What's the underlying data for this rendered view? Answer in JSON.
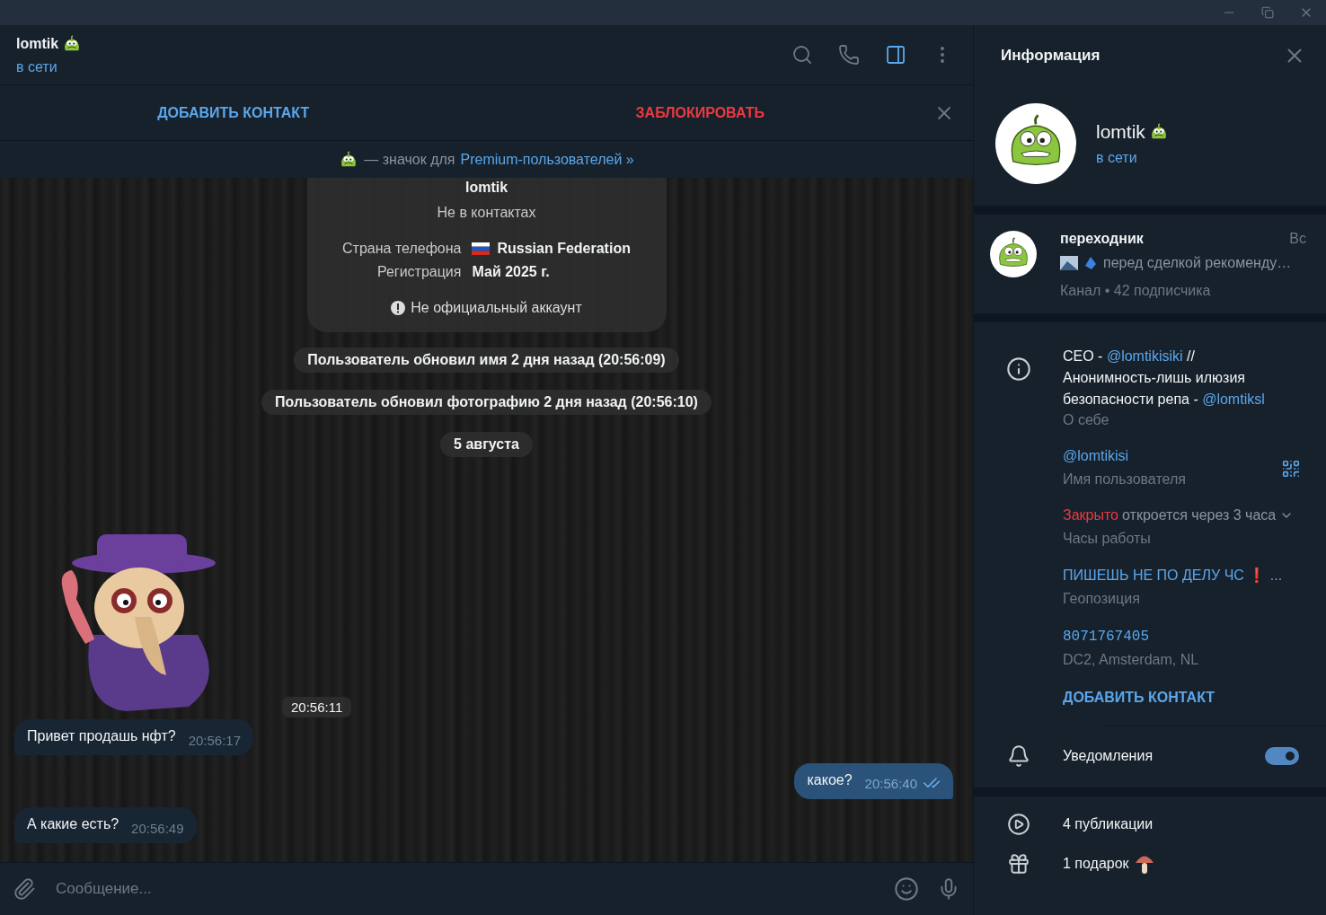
{
  "chat_header": {
    "name": "lomtik",
    "status": "в сети"
  },
  "action_bar": {
    "add_contact": "ДОБАВИТЬ КОНТАКТ",
    "block": "ЗАБЛОКИРОВАТЬ"
  },
  "premium_notice": {
    "text": "— значок для ",
    "link": "Premium-пользователей »"
  },
  "info_card": {
    "name": "lomtik",
    "subtitle": "Не в контактах",
    "rows": [
      {
        "label": "Страна телефона",
        "value": "Russian Federation",
        "kind": "country"
      },
      {
        "label": "Регистрация",
        "value": "Май 2025 г.",
        "kind": "date"
      }
    ],
    "note": "Не официальный аккаунт"
  },
  "messages": [
    {
      "kind": "service",
      "text": "Пользователь обновил имя 2 дня назад (20:56:09)"
    },
    {
      "kind": "service",
      "text": "Пользователь обновил фотографию 2 дня назад (20:56:10)"
    },
    {
      "kind": "date",
      "text": "5 августа"
    },
    {
      "kind": "sticker",
      "time": "20:56:11"
    },
    {
      "kind": "incoming",
      "text": "Привет продашь нфт?",
      "time": "20:56:17"
    },
    {
      "kind": "outgoing",
      "text": "какое?",
      "time": "20:56:40",
      "read": true
    },
    {
      "kind": "incoming",
      "text": "А какие есть?",
      "time": "20:56:49"
    }
  ],
  "composer": {
    "placeholder": "Сообщение..."
  },
  "info_panel": {
    "title": "Информация",
    "name": "lomtik",
    "status": "в сети",
    "channel": {
      "name": "переходник",
      "date": "Вс",
      "preview": "перед сделкой рекоменду…",
      "meta": "Канал • 42 подписчика"
    },
    "bio": {
      "parts": [
        {
          "text": "CEO - ",
          "link": false
        },
        {
          "text": "@lomtikisiki",
          "link": true
        },
        {
          "text": " //Анонимность-лишь илюзия безопасности репа - ",
          "link": false
        },
        {
          "text": "@lomtiksl",
          "link": true
        }
      ],
      "label": "О себе"
    },
    "username": {
      "value": "@lomtikisi",
      "label": "Имя пользователя"
    },
    "hours": {
      "status": "Закрыто",
      "detail": "откроется через 3 часа",
      "label": "Часы работы"
    },
    "location": {
      "value": "ПИШЕШЬ НЕ ПО ДЕЛУ ЧС ❗ ...",
      "label": "Геопозиция"
    },
    "id": {
      "value": "8071767405",
      "label": "DC2, Amsterdam, NL"
    },
    "add_contact": "ДОБАВИТЬ КОНТАКТ",
    "notifications": {
      "label": "Уведомления",
      "on": true
    },
    "stats": [
      {
        "kind": "stories",
        "text": "4 публикации"
      },
      {
        "kind": "gifts",
        "text": "1 подарок"
      }
    ]
  }
}
